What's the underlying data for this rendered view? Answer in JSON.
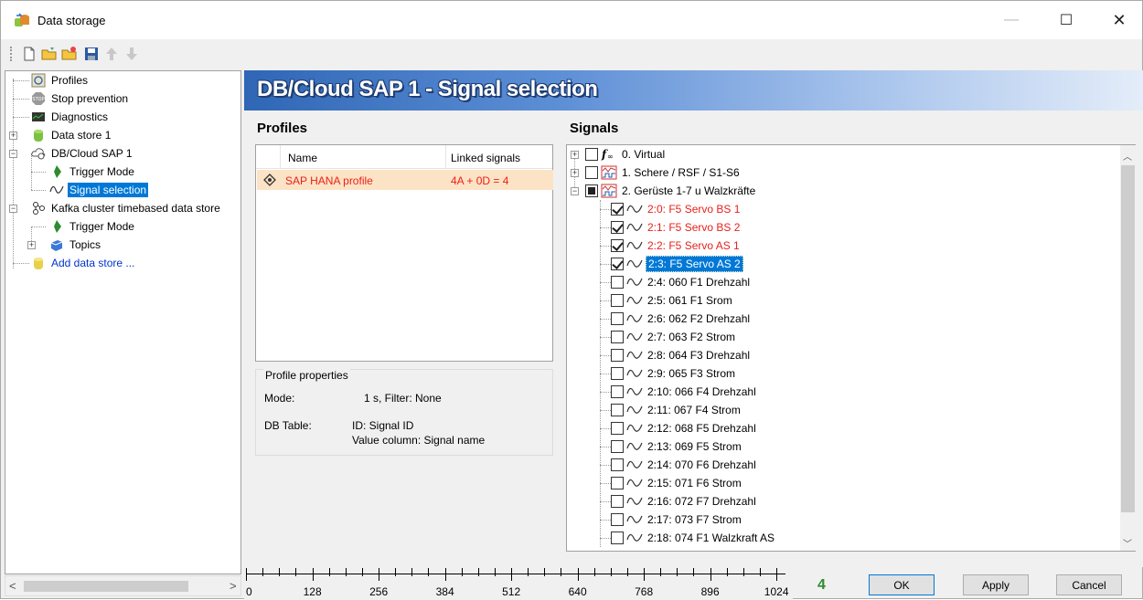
{
  "window": {
    "title": "Data storage"
  },
  "toolbar": {
    "icons": [
      "new-icon",
      "open-icon",
      "open-folder-icon",
      "save-icon",
      "move-up-icon",
      "move-down-icon"
    ]
  },
  "left_tree": {
    "items": [
      {
        "label": "Profiles",
        "icon": "profiles-icon"
      },
      {
        "label": "Stop prevention",
        "icon": "stop-icon"
      },
      {
        "label": "Diagnostics",
        "icon": "diagnostics-icon"
      },
      {
        "label": "Data store 1",
        "icon": "database-icon"
      },
      {
        "label": "DB/Cloud SAP 1",
        "icon": "cloud-db-icon"
      },
      {
        "label": "Trigger Mode",
        "icon": "trigger-icon"
      },
      {
        "label": "Signal selection",
        "icon": "signal-wave-icon"
      },
      {
        "label": "Kafka cluster timebased data store",
        "icon": "kafka-icon"
      },
      {
        "label": "Trigger Mode",
        "icon": "trigger-icon"
      },
      {
        "label": "Topics",
        "icon": "topics-icon"
      },
      {
        "label": "Add data store ...",
        "icon": "add-database-icon"
      }
    ]
  },
  "banner": {
    "title": "DB/Cloud SAP 1 - Signal selection"
  },
  "profiles": {
    "heading": "Profiles",
    "columns": [
      "Name",
      "Linked signals"
    ],
    "rows": [
      {
        "name": "SAP HANA profile",
        "linked": "4A + 0D = 4"
      }
    ]
  },
  "properties": {
    "legend": "Profile properties",
    "mode_label": "Mode:",
    "mode_value": "1 s, Filter: None",
    "table_label": "DB Table:",
    "table_value_1": "ID: Signal ID",
    "table_value_2": "Value column: Signal name"
  },
  "signals": {
    "heading": "Signals",
    "groups": [
      {
        "label": "0. Virtual"
      },
      {
        "label": "1. Schere / RSF / S1-S6"
      },
      {
        "label": "2. Gerüste 1-7  u  Walzkräfte"
      }
    ],
    "items": [
      {
        "label": "2:0: F5 Servo BS 1",
        "checked": true
      },
      {
        "label": "2:1: F5 Servo BS 2",
        "checked": true
      },
      {
        "label": "2:2: F5 Servo  AS 1",
        "checked": true
      },
      {
        "label": "2:3: F5 Servo AS 2",
        "checked": true
      },
      {
        "label": "2:4: 060 F1 Drehzahl",
        "checked": false
      },
      {
        "label": "2:5: 061 F1 Srom",
        "checked": false
      },
      {
        "label": "2:6: 062 F2 Drehzahl",
        "checked": false
      },
      {
        "label": "2:7: 063 F2 Strom",
        "checked": false
      },
      {
        "label": "2:8: 064 F3 Drehzahl",
        "checked": false
      },
      {
        "label": "2:9: 065 F3 Strom",
        "checked": false
      },
      {
        "label": "2:10: 066 F4 Drehzahl",
        "checked": false
      },
      {
        "label": "2:11: 067 F4 Strom",
        "checked": false
      },
      {
        "label": "2:12: 068 F5 Drehzahl",
        "checked": false
      },
      {
        "label": "2:13: 069 F5 Strom",
        "checked": false
      },
      {
        "label": "2:14: 070 F6 Drehzahl",
        "checked": false
      },
      {
        "label": "2:15: 071 F6 Strom",
        "checked": false
      },
      {
        "label": "2:16: 072 F7 Drehzahl",
        "checked": false
      },
      {
        "label": "2:17: 073 F7 Strom",
        "checked": false
      },
      {
        "label": "2:18: 074 F1 Walzkraft AS",
        "checked": false
      }
    ]
  },
  "ruler": {
    "labels": [
      "0",
      "128",
      "256",
      "384",
      "512",
      "640",
      "768",
      "896",
      "1024"
    ]
  },
  "footer": {
    "count": "4",
    "ok": "OK",
    "apply": "Apply",
    "cancel": "Cancel"
  },
  "colors": {
    "selection": "#0078d7",
    "checked_signal": "#e8211b",
    "count": "#2e8b2e",
    "profile_row": "#fde3c5"
  }
}
